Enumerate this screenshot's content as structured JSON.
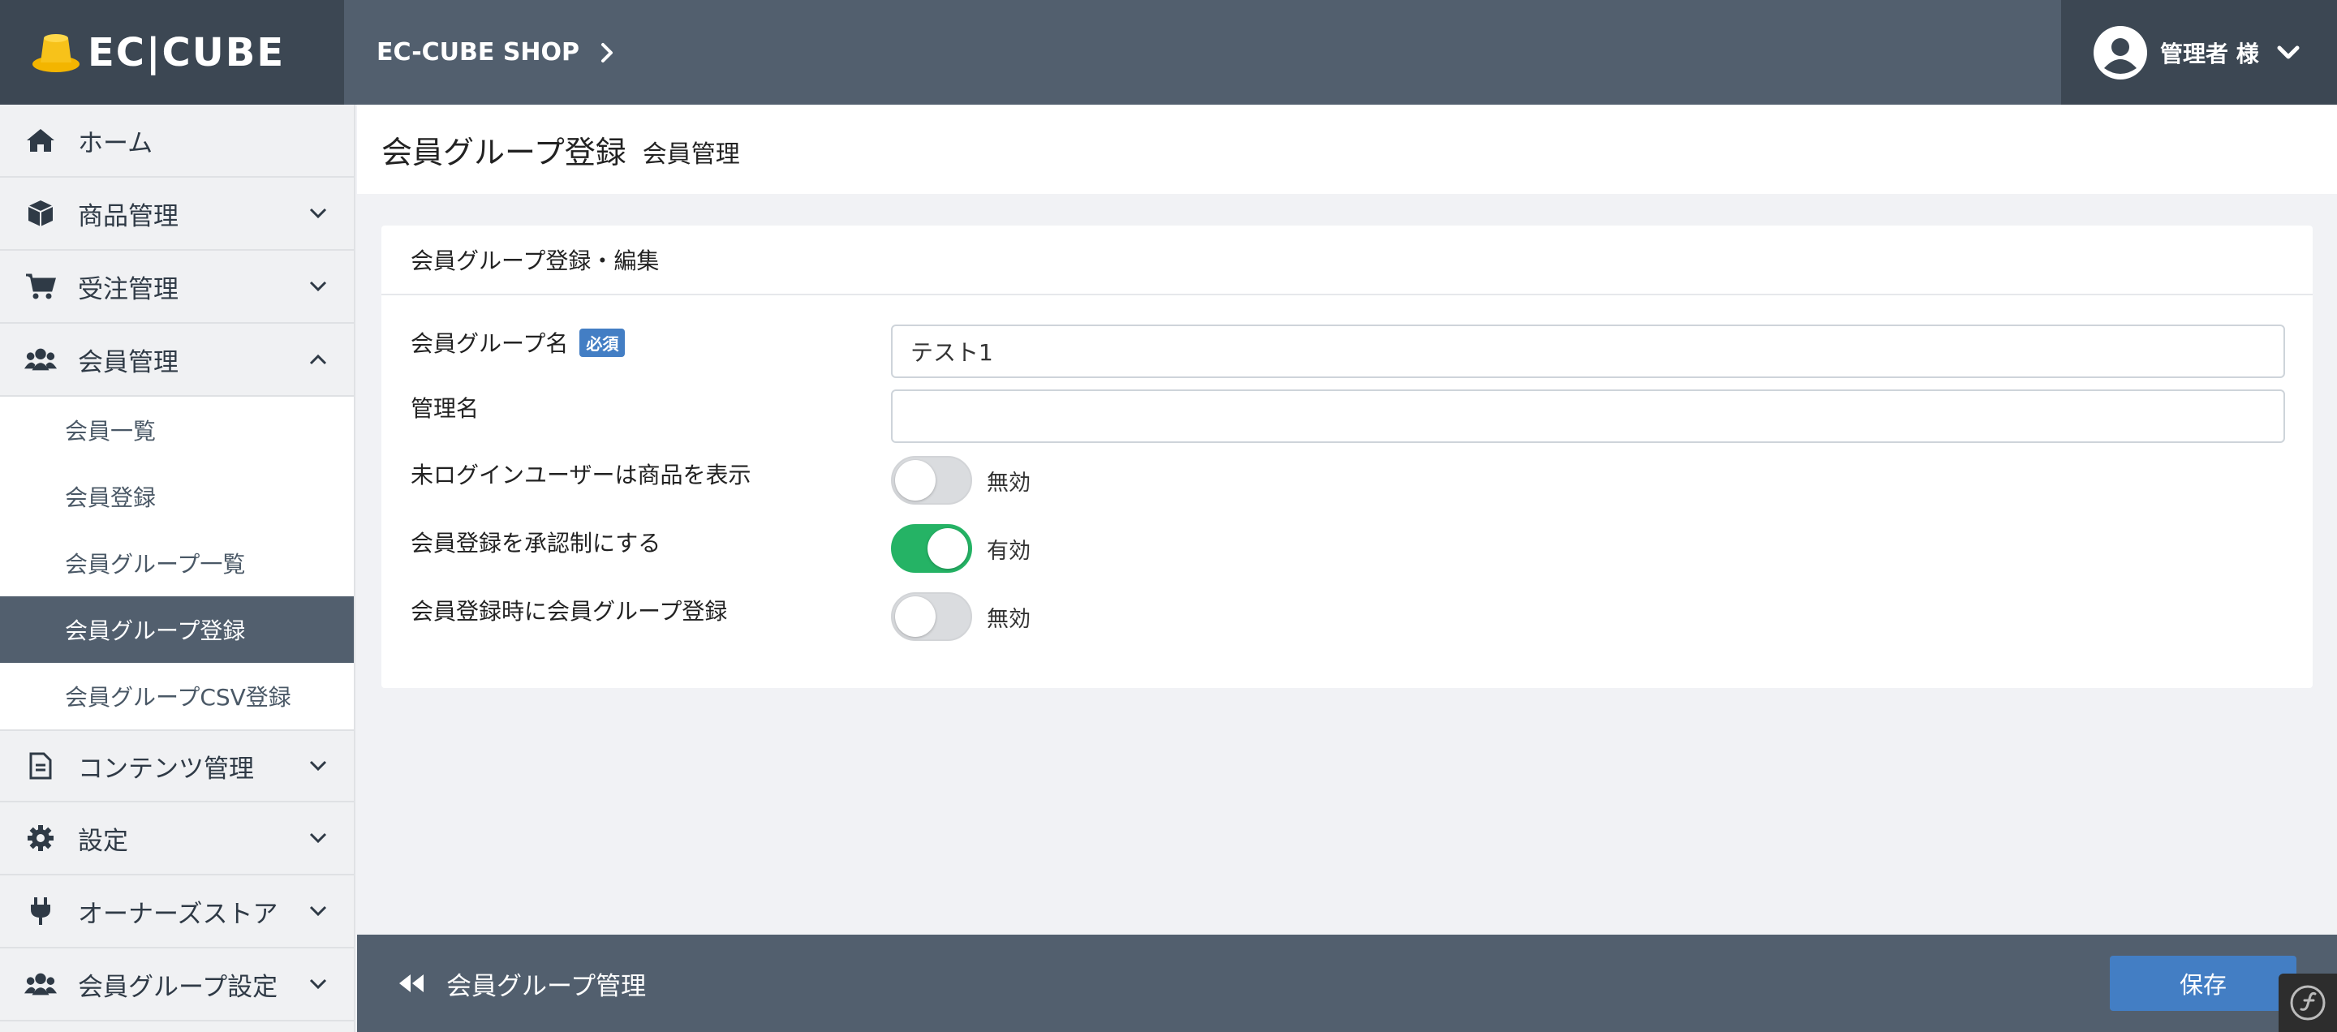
{
  "header": {
    "logo_text": "EC|CUBE",
    "shop_name": "EC-CUBE SHOP",
    "user_name": "管理者 様"
  },
  "sidebar": {
    "items": [
      {
        "label": "ホーム",
        "icon": "home-icon"
      },
      {
        "label": "商品管理",
        "icon": "box-icon"
      },
      {
        "label": "受注管理",
        "icon": "cart-icon"
      },
      {
        "label": "会員管理",
        "icon": "users-icon"
      },
      {
        "label": "コンテンツ管理",
        "icon": "document-icon"
      },
      {
        "label": "設定",
        "icon": "gear-icon"
      },
      {
        "label": "オーナーズストア",
        "icon": "plug-icon"
      },
      {
        "label": "会員グループ設定",
        "icon": "users-icon"
      }
    ],
    "sub_items": [
      {
        "label": "会員一覧"
      },
      {
        "label": "会員登録"
      },
      {
        "label": "会員グループ一覧"
      },
      {
        "label": "会員グループ登録",
        "active": true
      },
      {
        "label": "会員グループCSV登録"
      }
    ]
  },
  "page": {
    "title": "会員グループ登録",
    "subtitle": "会員管理"
  },
  "card": {
    "title": "会員グループ登録・編集",
    "fields": {
      "group_name_label": "会員グループ名",
      "required_badge": "必須",
      "group_name_value": "テスト1",
      "admin_name_label": "管理名",
      "admin_name_value": "",
      "guest_show_label": "未ログインユーザーは商品を表示",
      "guest_show_state": "無効",
      "approval_label": "会員登録を承認制にする",
      "approval_state": "有効",
      "register_group_label": "会員登録時に会員グループ登録",
      "register_group_state": "無効"
    }
  },
  "footer": {
    "back_label": "会員グループ管理",
    "save_label": "保存"
  },
  "colors": {
    "header_bg": "#525f6e",
    "accent_blue": "#437ec4",
    "toggle_on": "#25b365"
  }
}
